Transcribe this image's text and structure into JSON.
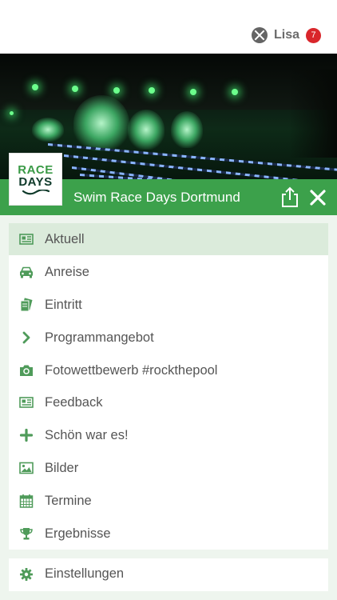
{
  "user": {
    "name": "Lisa",
    "notifications": "7"
  },
  "event": {
    "title": "Swim Race Days Dortmund",
    "logo_line1": "RACE",
    "logo_line2": "DAYS"
  },
  "menu": {
    "items": [
      {
        "label": "Aktuell",
        "icon": "news-icon",
        "active": true
      },
      {
        "label": "Anreise",
        "icon": "car-icon",
        "active": false
      },
      {
        "label": "Eintritt",
        "icon": "tickets-icon",
        "active": false
      },
      {
        "label": "Programmangebot",
        "icon": "chevron-right-icon",
        "active": false
      },
      {
        "label": "Fotowettbewerb #rockthepool",
        "icon": "camera-icon",
        "active": false
      },
      {
        "label": "Feedback",
        "icon": "news-icon",
        "active": false
      },
      {
        "label": "Schön war es!",
        "icon": "plus-icon",
        "active": false
      },
      {
        "label": "Bilder",
        "icon": "image-icon",
        "active": false
      },
      {
        "label": "Termine",
        "icon": "calendar-icon",
        "active": false
      },
      {
        "label": "Ergebnisse",
        "icon": "trophy-icon",
        "active": false
      }
    ],
    "settings": {
      "label": "Einstellungen",
      "icon": "gear-icon"
    }
  },
  "colors": {
    "brand_green": "#3ca14b",
    "active_row": "#dbebdb",
    "background": "#eef5ee",
    "badge_red": "#d9262b",
    "icon_green": "#4f9b5a"
  }
}
